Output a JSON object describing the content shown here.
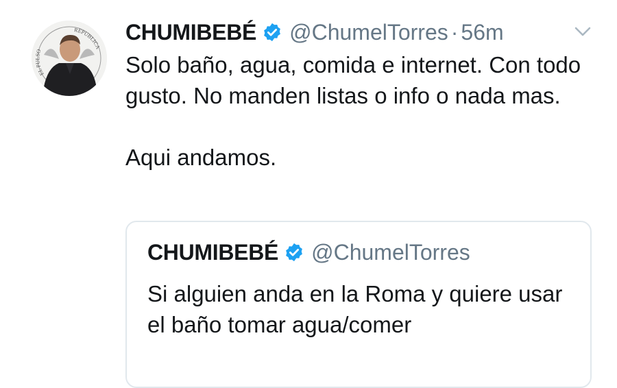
{
  "tweet": {
    "display_name": "CHUMIBEBÉ",
    "handle": "@ChumelTorres",
    "separator": "·",
    "time": "56m",
    "text": "Solo baño, agua, comida e internet. Con todo gusto. No manden listas o info o nada mas.\n\nAqui andamos.",
    "avatar_text_left": "EL PULSO",
    "avatar_text_right": "REPUBLICA"
  },
  "quoted_tweet": {
    "display_name": "CHUMIBEBÉ",
    "handle": "@ChumelTorres",
    "text": "Si alguien anda en la Roma y quiere usar el baño tomar agua/comer"
  },
  "colors": {
    "accent": "#1da1f2",
    "secondary_text": "#657786",
    "border": "#e1e8ed"
  },
  "icons": {
    "verified": "verified-badge-icon",
    "menu": "chevron-down-icon"
  }
}
